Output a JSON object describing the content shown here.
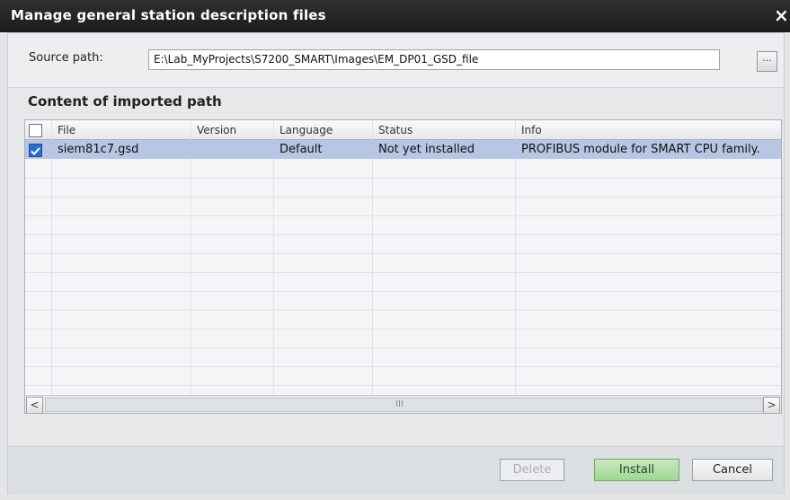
{
  "window": {
    "title": "Manage general station description files",
    "close_glyph": "×"
  },
  "source": {
    "label": "Source path:",
    "value": "E:\\Lab_MyProjects\\S7200_SMART\\Images\\EM_DP01_GSD_file",
    "browse_label": "..."
  },
  "content": {
    "heading": "Content of imported path"
  },
  "table": {
    "columns": [
      "File",
      "Version",
      "Language",
      "Status",
      "Info"
    ],
    "rows": [
      {
        "checked": true,
        "File": "siem81c7.gsd",
        "Version": "",
        "Language": "Default",
        "Status": "Not yet installed",
        "Info": "PROFIBUS module for SMART CPU family."
      }
    ]
  },
  "scroll": {
    "left_glyph": "<",
    "right_glyph": ">",
    "grip": "III"
  },
  "buttons": {
    "delete": "Delete",
    "install": "Install",
    "cancel": "Cancel"
  },
  "colors": {
    "selection": "#b6c6e4",
    "install_green": "#9fd594",
    "titlebar": "#1c1c1c"
  }
}
